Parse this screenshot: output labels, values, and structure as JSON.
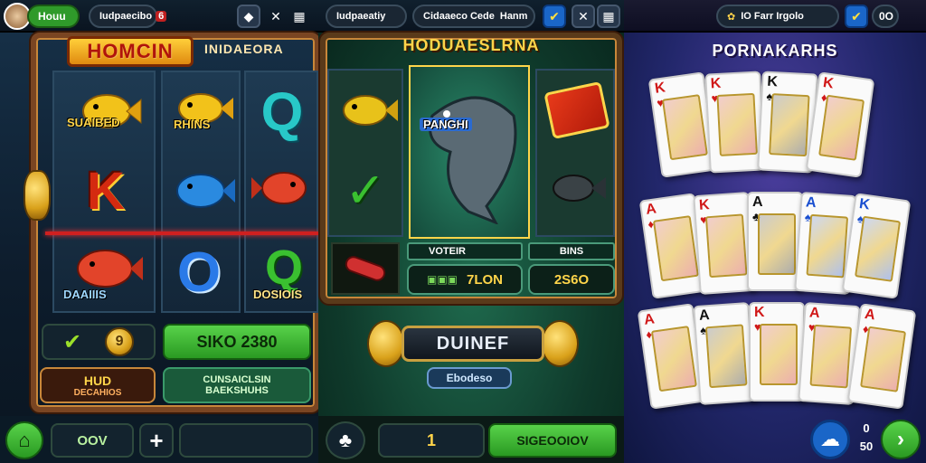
{
  "panel1": {
    "topbar": {
      "player_label": "Houu",
      "counter_label": "Iudpaecibo",
      "counter_badge": "6",
      "icon1": "chip-icon",
      "icon2": "close-icon",
      "icon3": "grid-icon"
    },
    "title": "HOMCIN",
    "subtitle": "INIDAEORA",
    "symbols": {
      "fish1": "SUAIBED",
      "fish2": "RHINS",
      "bottom": "DAAIIIS",
      "green": "DOSIOIS",
      "k_letter": "K"
    },
    "bet_box_value": "9",
    "spin_button": "SIKO 2380",
    "hud": {
      "title": "HUD",
      "sub": "DECAHIOS"
    },
    "info": {
      "line1": "CUNSAICLSIN",
      "line2": "BAEKSHUHS"
    },
    "bottom": {
      "home_icon": "home-icon",
      "field": "OOV",
      "plus_icon": "plus-icon",
      "empty_field": ""
    }
  },
  "panel2": {
    "topbar": {
      "label1": "Iudpaeatiy",
      "label2": "Cidaaeco Cede",
      "label3": "Hanm",
      "check_icon": "check-icon",
      "x_icon": "close-icon",
      "grid_icon": "grid-icon"
    },
    "title": "HODUAESLRNA",
    "fish_label": "PANGHI",
    "voter_label": "VOTEIR",
    "bins_label": "BINS",
    "value_left": "7LON",
    "value_right": "2S6O",
    "main_button": "DUINEF",
    "sub_button": "Ebodeso",
    "bottom": {
      "chip_icon": "chip-icon",
      "counter": "1",
      "action_button": "SIGEOOIOV"
    }
  },
  "panel3": {
    "topbar": {
      "label": "IO Farr Irgolo",
      "check_icon": "check-icon",
      "counter": "0O"
    },
    "title": "PORNAKARHS",
    "cards_row1": [
      {
        "rank": "K",
        "suit": "♥",
        "color": "#d01818"
      },
      {
        "rank": "K",
        "suit": "♥",
        "color": "#d01818"
      },
      {
        "rank": "K",
        "suit": "♠",
        "color": "#111111"
      },
      {
        "rank": "K",
        "suit": "♦",
        "color": "#d01818"
      }
    ],
    "cards_row2": [
      {
        "rank": "A",
        "suit": "♦",
        "color": "#d01818"
      },
      {
        "rank": "K",
        "suit": "♥",
        "color": "#d01818"
      },
      {
        "rank": "A",
        "suit": "♣",
        "color": "#111111"
      },
      {
        "rank": "A",
        "suit": "♠",
        "color": "#1a4fd0"
      },
      {
        "rank": "K",
        "suit": "♠",
        "color": "#1a4fd0"
      }
    ],
    "cards_row3": [
      {
        "rank": "A",
        "suit": "♦",
        "color": "#d01818"
      },
      {
        "rank": "A",
        "suit": "♠",
        "color": "#111111"
      },
      {
        "rank": "K",
        "suit": "♥",
        "color": "#d01818"
      },
      {
        "rank": "A",
        "suit": "♥",
        "color": "#d01818"
      },
      {
        "rank": "A",
        "suit": "♦",
        "color": "#d01818"
      }
    ],
    "bottom": {
      "cloud_icon": "cloud-icon",
      "count_top": "0",
      "count_bottom": "50",
      "next_icon": "chevron-right-icon"
    }
  },
  "colors": {
    "accent_green": "#3fbf2f",
    "gold": "#ffd54a",
    "wood": "#7a4522"
  }
}
